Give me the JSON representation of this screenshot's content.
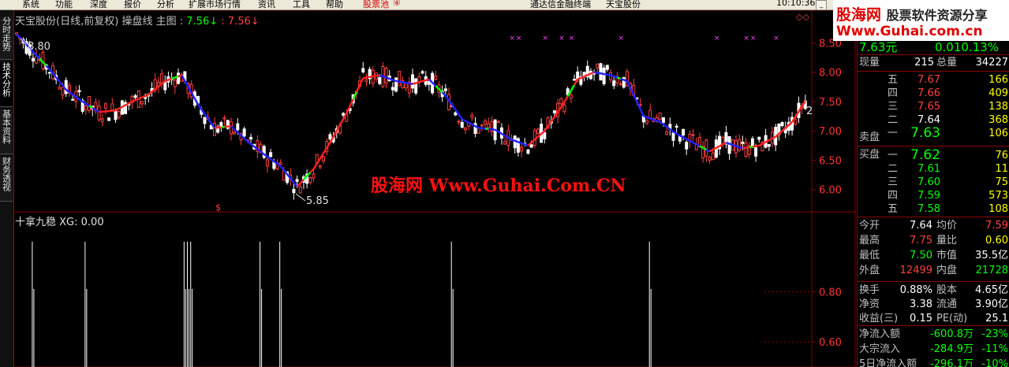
{
  "menu": {
    "items": [
      "系统",
      "功能",
      "深度",
      "报价",
      "分析",
      "扩展市场行情",
      "资讯",
      "工具",
      "帮助"
    ],
    "stock_pool": "股票池",
    "stock_pool_badge": "④",
    "center_title": "通达信金融终端",
    "center_stock": "天宝股份",
    "clock": "10:10:36"
  },
  "side_tabs": [
    "分时走势",
    "技术分析",
    "基本资料",
    "财务透视"
  ],
  "chart_header": {
    "stock": "天宝股份",
    "period": "(日线,前复权)",
    "indicator": "操盘线",
    "main_label": "主图",
    "colon": ":",
    "value1": "7.56↓",
    "value2": "7.56↓",
    "corner": "◇◇"
  },
  "annotations": {
    "high_label": "8.80",
    "low_label": "5.85",
    "right_mark": "2",
    "dollar_mark": "$",
    "x_marks": "×"
  },
  "lower_panel": {
    "title": "十拿九稳",
    "xg_label": "XG:",
    "xg_value": "0.00"
  },
  "chart_data": {
    "type": "line",
    "price_axis_ticks": [
      "8.50",
      "8.00",
      "7.50",
      "7.00",
      "6.50",
      "6.00"
    ],
    "indicator_axis_ticks": [
      "0.80",
      "0.60"
    ],
    "series": [
      {
        "name": "操盘线",
        "x": [
          0,
          5,
          10,
          15,
          20,
          25,
          30,
          35,
          40,
          45,
          50,
          55,
          60,
          65,
          70,
          75,
          80,
          85,
          90,
          95,
          100,
          105,
          110,
          115,
          120,
          125,
          130,
          135,
          140,
          145,
          150,
          155,
          160,
          165,
          170,
          175,
          180,
          185,
          190,
          195,
          200,
          205,
          210,
          215,
          220,
          225,
          230,
          235,
          240
        ],
        "y": [
          8.65,
          8.35,
          8.05,
          7.7,
          7.5,
          7.32,
          7.35,
          7.5,
          7.62,
          7.85,
          7.95,
          7.45,
          7.05,
          7.08,
          6.82,
          6.6,
          6.4,
          6.05,
          6.35,
          6.8,
          7.3,
          7.9,
          7.95,
          7.85,
          7.8,
          7.88,
          7.6,
          7.2,
          7.05,
          7.02,
          6.85,
          6.75,
          7.0,
          7.4,
          7.88,
          8.0,
          7.95,
          7.85,
          7.25,
          7.15,
          6.95,
          6.8,
          6.65,
          6.8,
          6.7,
          6.75,
          6.9,
          7.15,
          7.6
        ]
      },
      {
        "name": "XG",
        "x": [
          5,
          21,
          51,
          52,
          53,
          74,
          80,
          132,
          192
        ],
        "y": [
          1,
          1,
          1,
          1,
          1,
          1,
          1,
          1,
          1
        ]
      }
    ]
  },
  "quote": {
    "header_price": "7.63元",
    "header_change": "0.010.13%",
    "now_vol_label": "现量",
    "now_vol": "215",
    "total_vol_label": "总量",
    "total_vol": "34227",
    "asks": [
      {
        "label": "五",
        "price": "7.67",
        "vol": "166"
      },
      {
        "label": "四",
        "price": "7.66",
        "vol": "409"
      },
      {
        "label": "三",
        "price": "7.65",
        "vol": "138"
      },
      {
        "label": "二",
        "price": "7.64",
        "vol": "368"
      },
      {
        "label": "一",
        "price": "7.63",
        "vol": "106"
      }
    ],
    "ask_side_label": "卖盘",
    "bid_side_label": "买盘",
    "bids": [
      {
        "label": "一",
        "price": "7.62",
        "vol": "76"
      },
      {
        "label": "二",
        "price": "7.61",
        "vol": "11"
      },
      {
        "label": "三",
        "price": "7.60",
        "vol": "75"
      },
      {
        "label": "四",
        "price": "7.59",
        "vol": "573"
      },
      {
        "label": "五",
        "price": "7.58",
        "vol": "108"
      }
    ],
    "stats": [
      {
        "l1": "今开",
        "v1": "7.64",
        "l2": "均价",
        "v2": "7.59",
        "c1": "#ffffff",
        "c2": "#ff4040"
      },
      {
        "l1": "最高",
        "v1": "7.75",
        "l2": "量比",
        "v2": "0.60",
        "c1": "#ff4040",
        "c2": "#ffff00"
      },
      {
        "l1": "最低",
        "v1": "7.50",
        "l2": "市值",
        "v2": "35.5亿",
        "c1": "#00ff00",
        "c2": "#ffffff"
      },
      {
        "l1": "外盘",
        "v1": "12499",
        "l2": "内盘",
        "v2": "21728",
        "c1": "#ff4040",
        "c2": "#00ff00"
      }
    ],
    "stats2": [
      {
        "l1": "换手",
        "v1": "0.88%",
        "l2": "股本",
        "v2": "4.65亿"
      },
      {
        "l1": "净资",
        "v1": "3.38",
        "l2": "流通",
        "v2": "3.90亿"
      },
      {
        "l1": "收益(三)",
        "v1": "0.15",
        "l2": "PE(动)",
        "v2": "25.1"
      }
    ],
    "flows": [
      {
        "label": "净流入额",
        "value": "-600.8万",
        "pct": "-23%"
      },
      {
        "label": "大宗流入",
        "value": "-284.9万",
        "pct": "-11%"
      },
      {
        "label": "5日净流入额",
        "value": "-296.1万",
        "pct": "-10%"
      }
    ]
  },
  "logo": {
    "cn": "股海网",
    "slogan": "股票软件资源分享",
    "url": "Www.Guhai.com.cn"
  },
  "watermark": "股海网 Www.Guhai.Com.CN",
  "colors": {
    "up": "#ff4040",
    "down": "#00ff00",
    "grid": "#8b0000",
    "ma_up": "#ff2020",
    "ma_down": "#2020ff"
  }
}
